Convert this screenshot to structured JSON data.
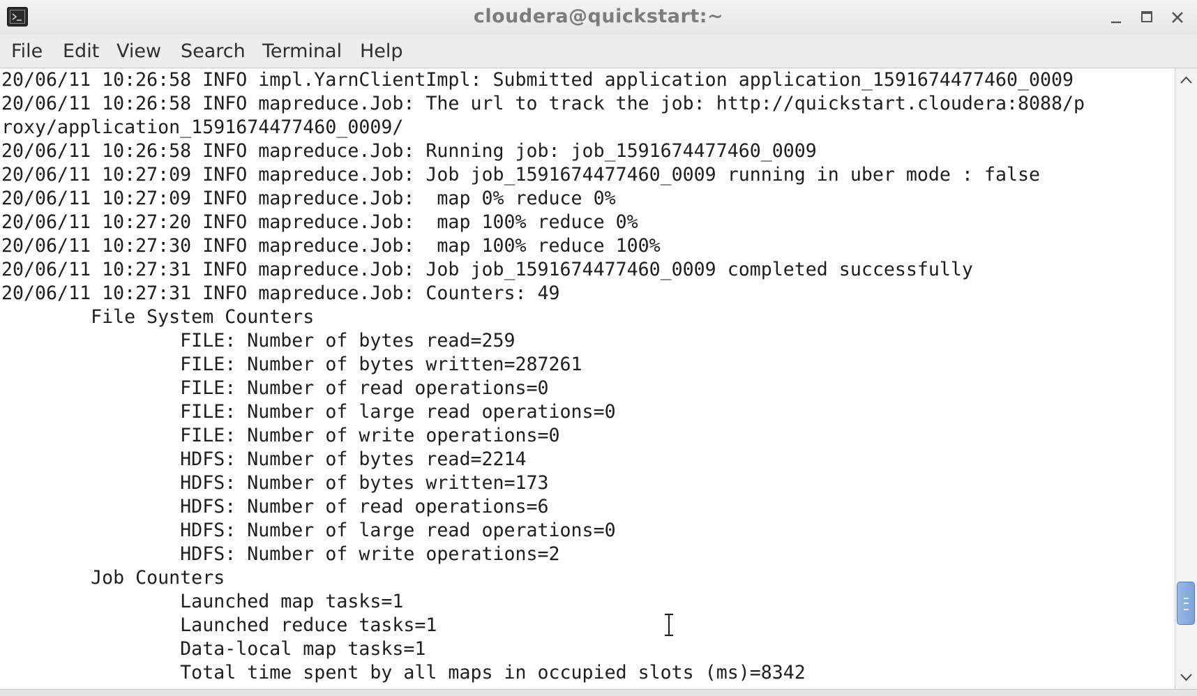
{
  "window": {
    "title": "cloudera@quickstart:~",
    "icon": "terminal-icon",
    "controls": [
      "minimize-icon",
      "maximize-icon",
      "close-icon"
    ]
  },
  "menubar": {
    "items": [
      "File",
      "Edit",
      "View",
      "Search",
      "Terminal",
      "Help"
    ]
  },
  "terminal": {
    "lines": [
      "20/06/11 10:26:58 INFO impl.YarnClientImpl: Submitted application application_1591674477460_0009",
      "20/06/11 10:26:58 INFO mapreduce.Job: The url to track the job: http://quickstart.cloudera:8088/p",
      "roxy/application_1591674477460_0009/",
      "20/06/11 10:26:58 INFO mapreduce.Job: Running job: job_1591674477460_0009",
      "20/06/11 10:27:09 INFO mapreduce.Job: Job job_1591674477460_0009 running in uber mode : false",
      "20/06/11 10:27:09 INFO mapreduce.Job:  map 0% reduce 0%",
      "20/06/11 10:27:20 INFO mapreduce.Job:  map 100% reduce 0%",
      "20/06/11 10:27:30 INFO mapreduce.Job:  map 100% reduce 100%",
      "20/06/11 10:27:31 INFO mapreduce.Job: Job job_1591674477460_0009 completed successfully",
      "20/06/11 10:27:31 INFO mapreduce.Job: Counters: 49",
      "        File System Counters",
      "                FILE: Number of bytes read=259",
      "                FILE: Number of bytes written=287261",
      "                FILE: Number of read operations=0",
      "                FILE: Number of large read operations=0",
      "                FILE: Number of write operations=0",
      "                HDFS: Number of bytes read=2214",
      "                HDFS: Number of bytes written=173",
      "                HDFS: Number of read operations=6",
      "                HDFS: Number of large read operations=0",
      "                HDFS: Number of write operations=2",
      "        Job Counters",
      "                Launched map tasks=1",
      "                Launched reduce tasks=1",
      "                Data-local map tasks=1",
      "                Total time spent by all maps in occupied slots (ms)=8342"
    ]
  },
  "scrollbar": {
    "position_fraction": 0.92
  },
  "colors": {
    "background": "#ffffff",
    "text": "#1e1e1e",
    "titlebar": "#ececec",
    "menubar": "#ededed",
    "scroll_thumb": "#7aa2d9"
  }
}
